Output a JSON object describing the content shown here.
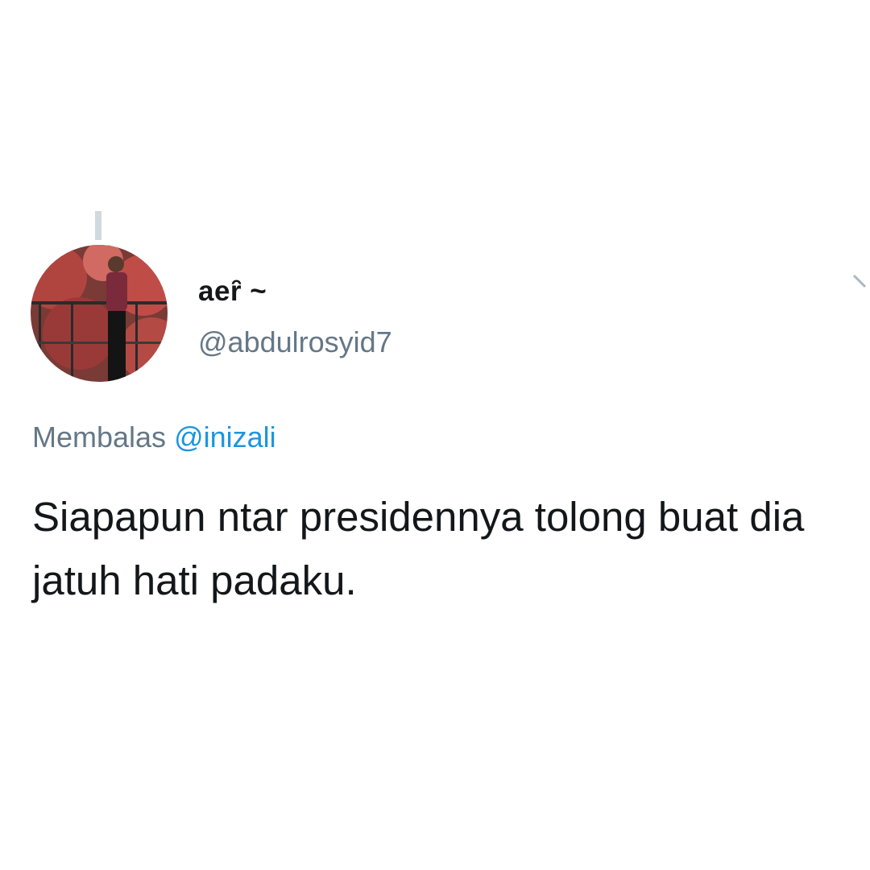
{
  "tweet": {
    "display_name": "aeȓ ~",
    "handle": "@abdulrosyid7",
    "reply_prefix": "Membalas",
    "reply_to": "@inizali",
    "text": "Siapapun ntar presidennya tolong buat dia jatuh hati padaku."
  },
  "icons": {
    "avatar": "profile-photo-avatar",
    "menu": "chevron-down-icon"
  },
  "colors": {
    "text_primary": "#14171a",
    "text_secondary": "#657786",
    "link": "#1b95e0",
    "thread_line": "#cfd9de"
  }
}
